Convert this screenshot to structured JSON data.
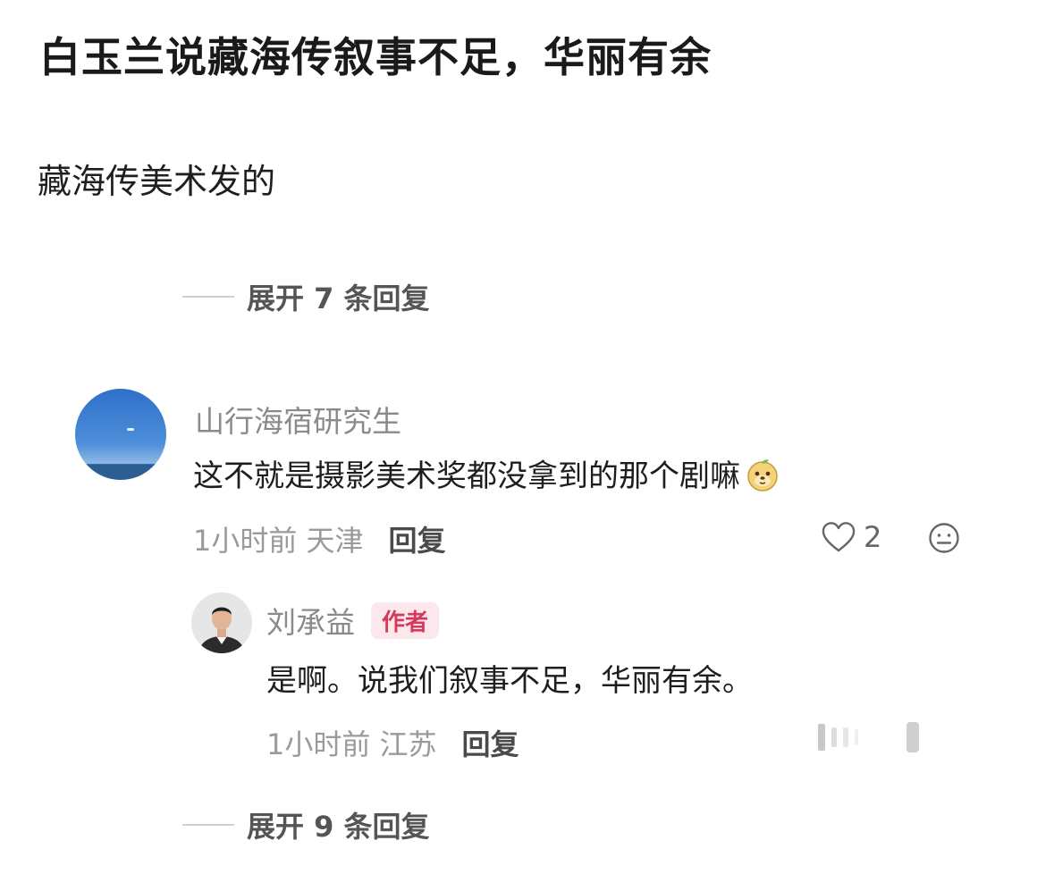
{
  "post": {
    "title": "白玉兰说藏海传叙事不足，华丽有余",
    "text": "藏海传美术发的"
  },
  "expand_top": {
    "label": "展开 7 条回复"
  },
  "comment": {
    "username": "山行海宿研究生",
    "text": "这不就是摄影美术奖都没拿到的那个剧嘛",
    "emoji_icon": "doge-emoji-icon",
    "time_location": "1小时前 天津",
    "reply_label": "回复",
    "like_count": "2"
  },
  "reply": {
    "username": "刘承益",
    "badge": "作者",
    "text": "是啊。说我们叙事不足，华丽有余。",
    "time_location": "1小时前 江苏",
    "reply_label": "回复"
  },
  "expand_bottom": {
    "label": "展开 9 条回复"
  },
  "colors": {
    "badge_text": "#d43a5c",
    "badge_bg": "#fbe7ec",
    "muted": "#9a9a9a"
  }
}
